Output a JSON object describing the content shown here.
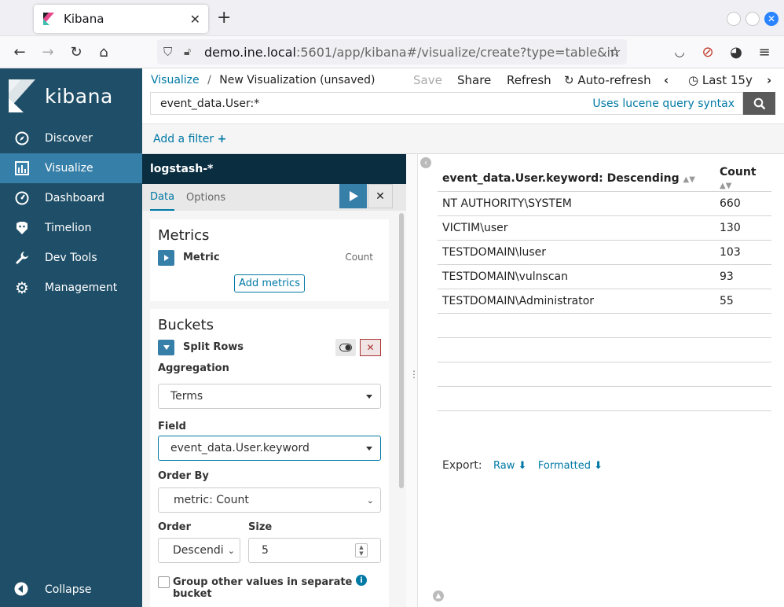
{
  "browser": {
    "tab_title": "Kibana",
    "url_host": "demo.ine.local",
    "url_rest": ":5601/app/kibana#/visualize/create?type=table&in"
  },
  "sidebar": {
    "logo_text": "kibana",
    "items": [
      {
        "label": "Discover",
        "icon": "compass-icon"
      },
      {
        "label": "Visualize",
        "icon": "bar-chart-icon",
        "active": true
      },
      {
        "label": "Dashboard",
        "icon": "dashboard-icon"
      },
      {
        "label": "Timelion",
        "icon": "timelion-icon"
      },
      {
        "label": "Dev Tools",
        "icon": "wrench-icon"
      },
      {
        "label": "Management",
        "icon": "gear-icon"
      }
    ],
    "collapse_label": "Collapse"
  },
  "header": {
    "breadcrumb_root": "Visualize",
    "breadcrumb_sep": "/",
    "breadcrumb_current": "New Visualization (unsaved)",
    "save": "Save",
    "share": "Share",
    "refresh": "Refresh",
    "auto_refresh": "Auto-refresh",
    "time_range": "Last 15y"
  },
  "query": {
    "value": "event_data.User:*",
    "hint": "Uses lucene query syntax"
  },
  "filter": {
    "add_label": "Add a filter"
  },
  "editor": {
    "index_pattern": "logstash-*",
    "tabs": [
      "Data",
      "Options"
    ],
    "metrics": {
      "title": "Metrics",
      "metric_label": "Metric",
      "metric_value": "Count",
      "add_button": "Add metrics"
    },
    "buckets": {
      "title": "Buckets",
      "split_label": "Split Rows",
      "aggregation_label": "Aggregation",
      "aggregation_value": "Terms",
      "field_label": "Field",
      "field_value": "event_data.User.keyword",
      "orderby_label": "Order By",
      "orderby_value": "metric: Count",
      "order_label": "Order",
      "order_value": "Descendi",
      "size_label": "Size",
      "size_value": "5",
      "group_other_label": "Group other values in separate bucket"
    }
  },
  "table": {
    "columns": [
      "event_data.User.keyword: Descending",
      "Count"
    ],
    "rows": [
      [
        "NT AUTHORITY\\SYSTEM",
        "660"
      ],
      [
        "VICTIM\\user",
        "130"
      ],
      [
        "TESTDOMAIN\\luser",
        "103"
      ],
      [
        "TESTDOMAIN\\vulnscan",
        "93"
      ],
      [
        "TESTDOMAIN\\Administrator",
        "55"
      ]
    ],
    "export_label": "Export:",
    "export_raw": "Raw",
    "export_formatted": "Formatted"
  },
  "colors": {
    "sidebar_bg": "#1f4f68",
    "sidebar_active": "#367fa8",
    "link": "#0079a5",
    "index_bar": "#0a2d40"
  }
}
